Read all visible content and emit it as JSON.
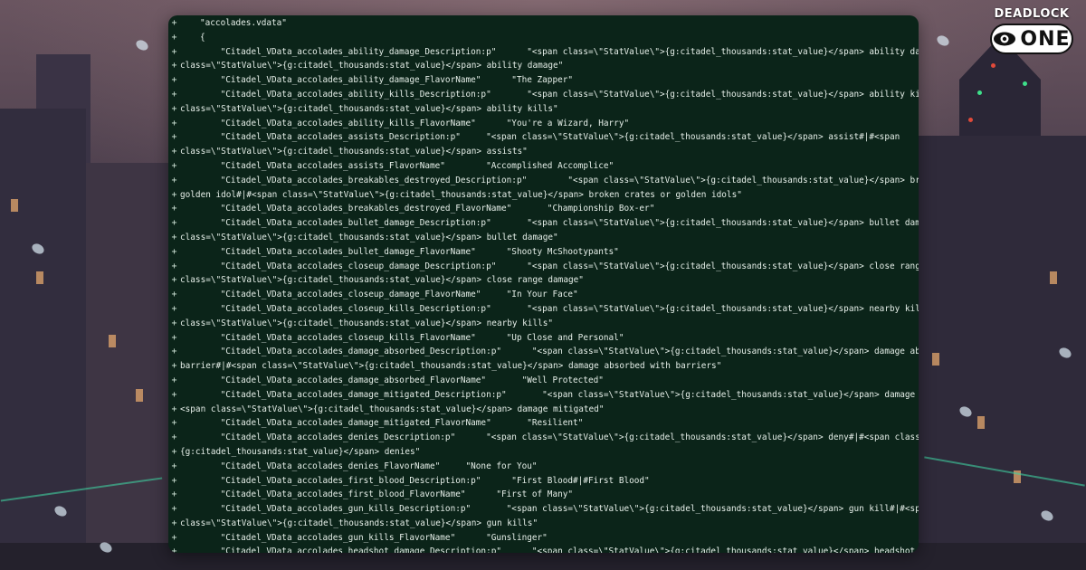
{
  "logo": {
    "top_text": "DEADLOCK",
    "pill_text": "ONE",
    "icon": "eye-icon"
  },
  "colors": {
    "panel_bg": "#0b2419",
    "code_text": "#e6efe9",
    "diff_marker": "#cfe3d6"
  },
  "diff": {
    "marker": "+",
    "lines": [
      {
        "text": "\"accolades.vdata\""
      },
      {
        "text": "{"
      },
      {
        "text": "    \"Citadel_VData_accolades_ability_damage_Description:p\"      \"<span class=\\\"StatValue\\\">{g:citadel_thousands:stat_value}</span> ability damage#|#<span"
      },
      {
        "text": "class=\\\"StatValue\\\">{g:citadel_thousands:stat_value}</span> ability damage\"",
        "continuation": true
      },
      {
        "text": "    \"Citadel_VData_accolades_ability_damage_FlavorName\"      \"The Zapper\""
      },
      {
        "text": "    \"Citadel_VData_accolades_ability_kills_Description:p\"       \"<span class=\\\"StatValue\\\">{g:citadel_thousands:stat_value}</span> ability kill#|#<span"
      },
      {
        "text": "class=\\\"StatValue\\\">{g:citadel_thousands:stat_value}</span> ability kills\"",
        "continuation": true
      },
      {
        "text": "    \"Citadel_VData_accolades_ability_kills_FlavorName\"      \"You're a Wizard, Harry\""
      },
      {
        "text": "    \"Citadel_VData_accolades_assists_Description:p\"     \"<span class=\\\"StatValue\\\">{g:citadel_thousands:stat_value}</span> assist#|#<span"
      },
      {
        "text": "class=\\\"StatValue\\\">{g:citadel_thousands:stat_value}</span> assists\"",
        "continuation": true
      },
      {
        "text": "    \"Citadel_VData_accolades_assists_FlavorName\"        \"Accomplished Accomplice\""
      },
      {
        "text": "    \"Citadel_VData_accolades_breakables_destroyed_Description:p\"        \"<span class=\\\"StatValue\\\">{g:citadel_thousands:stat_value}</span> broken crate or"
      },
      {
        "text": "golden idol#|#<span class=\\\"StatValue\\\">{g:citadel_thousands:stat_value}</span> broken crates or golden idols\"",
        "continuation": true
      },
      {
        "text": "    \"Citadel_VData_accolades_breakables_destroyed_FlavorName\"       \"Championship Box-er\""
      },
      {
        "text": "    \"Citadel_VData_accolades_bullet_damage_Description:p\"       \"<span class=\\\"StatValue\\\">{g:citadel_thousands:stat_value}</span> bullet damage#|#<span"
      },
      {
        "text": "class=\\\"StatValue\\\">{g:citadel_thousands:stat_value}</span> bullet damage\"",
        "continuation": true
      },
      {
        "text": "    \"Citadel_VData_accolades_bullet_damage_FlavorName\"      \"Shooty McShootypants\""
      },
      {
        "text": "    \"Citadel_VData_accolades_closeup_damage_Description:p\"      \"<span class=\\\"StatValue\\\">{g:citadel_thousands:stat_value}</span> close range damage#|#<span"
      },
      {
        "text": "class=\\\"StatValue\\\">{g:citadel_thousands:stat_value}</span> close range damage\"",
        "continuation": true
      },
      {
        "text": "    \"Citadel_VData_accolades_closeup_damage_FlavorName\"     \"In Your Face\""
      },
      {
        "text": "    \"Citadel_VData_accolades_closeup_kills_Description:p\"       \"<span class=\\\"StatValue\\\">{g:citadel_thousands:stat_value}</span> nearby kill#|#<span"
      },
      {
        "text": "class=\\\"StatValue\\\">{g:citadel_thousands:stat_value}</span> nearby kills\"",
        "continuation": true
      },
      {
        "text": "    \"Citadel_VData_accolades_closeup_kills_FlavorName\"      \"Up Close and Personal\""
      },
      {
        "text": "    \"Citadel_VData_accolades_damage_absorbed_Description:p\"      \"<span class=\\\"StatValue\\\">{g:citadel_thousands:stat_value}</span> damage absorbed with a"
      },
      {
        "text": "barrier#|#<span class=\\\"StatValue\\\">{g:citadel_thousands:stat_value}</span> damage absorbed with barriers\"",
        "continuation": true
      },
      {
        "text": "    \"Citadel_VData_accolades_damage_absorbed_FlavorName\"       \"Well Protected\""
      },
      {
        "text": "    \"Citadel_VData_accolades_damage_mitigated_Description:p\"       \"<span class=\\\"StatValue\\\">{g:citadel_thousands:stat_value}</span> damage mitigated#|#"
      },
      {
        "text": "<span class=\\\"StatValue\\\">{g:citadel_thousands:stat_value}</span> damage mitigated\"",
        "continuation": true
      },
      {
        "text": "    \"Citadel_VData_accolades_damage_mitigated_FlavorName\"       \"Resilient\""
      },
      {
        "text": "    \"Citadel_VData_accolades_denies_Description:p\"      \"<span class=\\\"StatValue\\\">{g:citadel_thousands:stat_value}</span> deny#|#<span class=\\\"StatValue\\\">"
      },
      {
        "text": "{g:citadel_thousands:stat_value}</span> denies\"",
        "continuation": true
      },
      {
        "text": "    \"Citadel_VData_accolades_denies_FlavorName\"     \"None for You\""
      },
      {
        "text": "    \"Citadel_VData_accolades_first_blood_Description:p\"      \"First Blood#|#First Blood\""
      },
      {
        "text": "    \"Citadel_VData_accolades_first_blood_FlavorName\"      \"First of Many\""
      },
      {
        "text": "    \"Citadel_VData_accolades_gun_kills_Description:p\"       \"<span class=\\\"StatValue\\\">{g:citadel_thousands:stat_value}</span> gun kill#|#<span"
      },
      {
        "text": "class=\\\"StatValue\\\">{g:citadel_thousands:stat_value}</span> gun kills\"",
        "continuation": true
      },
      {
        "text": "    \"Citadel_VData_accolades_gun_kills_FlavorName\"      \"Gunslinger\""
      },
      {
        "text": "    \"Citadel_VData_accolades_headshot_damage_Description:p\"      \"<span class=\\\"StatValue\\\">{g:citadel_thousands:stat_value}</span> headshot damage#|#<span"
      }
    ]
  }
}
